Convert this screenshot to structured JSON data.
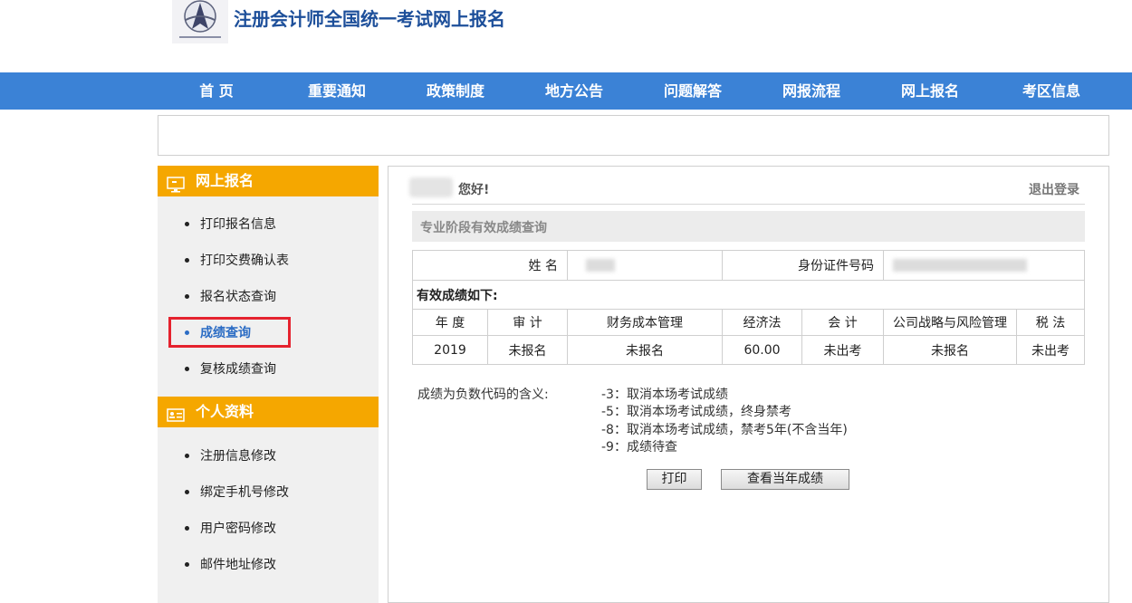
{
  "header": {
    "title": "注册会计师全国统一考试网上报名"
  },
  "nav": {
    "items": [
      "首 页",
      "重要通知",
      "政策制度",
      "地方公告",
      "问题解答",
      "网报流程",
      "网上报名",
      "考区信息"
    ]
  },
  "sidebar": {
    "section1": {
      "title": "网上报名",
      "icon": "monitor-icon",
      "items": [
        "打印报名信息",
        "打印交费确认表",
        "报名状态查询",
        "成绩查询",
        "复核成绩查询"
      ]
    },
    "section2": {
      "title": "个人资料",
      "icon": "id-card-icon",
      "items": [
        "注册信息修改",
        "绑定手机号修改",
        "用户密码修改",
        "邮件地址修改"
      ]
    },
    "active_item": "成绩查询"
  },
  "main": {
    "greeting": "您好!",
    "logout": "退出登录",
    "section_title": "专业阶段有效成绩查询",
    "name_label": "姓 名",
    "id_label": "身份证件号码",
    "valid_scores_label": "有效成绩如下:",
    "columns": [
      "年 度",
      "审 计",
      "财务成本管理",
      "经济法",
      "会 计",
      "公司战略与风险管理",
      "税 法"
    ],
    "row": [
      "2019",
      "未报名",
      "未报名",
      "60.00",
      "未出考",
      "未报名",
      "未出考"
    ],
    "legend_title": "成绩为负数代码的含义:",
    "legend": [
      "-3：取消本场考试成绩",
      "-5：取消本场考试成绩，终身禁考",
      "-8：取消本场考试成绩，禁考5年(不含当年)",
      "-9：成绩待查"
    ],
    "print_button": "打印",
    "view_year_button": "查看当年成绩"
  },
  "colors": {
    "nav_bg": "#3b82d6",
    "sidebar_head": "#f5a700",
    "title": "#1d4f9a",
    "highlight": "#e5222e"
  }
}
